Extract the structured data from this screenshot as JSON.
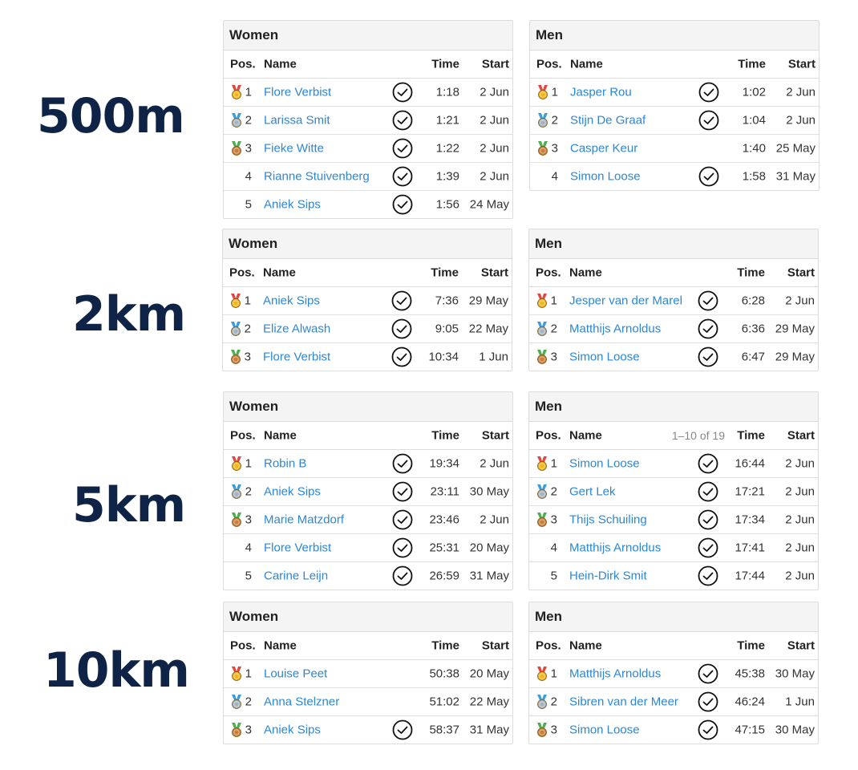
{
  "distances": [
    {
      "label": "500m",
      "women": {
        "title": "Women",
        "range": "",
        "rows": [
          {
            "pos": "1",
            "medal": "gold",
            "name": "Flore Verbist",
            "check": true,
            "time": "1:18",
            "start": "2 Jun"
          },
          {
            "pos": "2",
            "medal": "silver",
            "name": "Larissa Smit",
            "check": true,
            "time": "1:21",
            "start": "2 Jun"
          },
          {
            "pos": "3",
            "medal": "bronze",
            "name": "Fieke Witte",
            "check": true,
            "time": "1:22",
            "start": "2 Jun"
          },
          {
            "pos": "4",
            "medal": "",
            "name": "Rianne Stuivenberg",
            "check": true,
            "time": "1:39",
            "start": "2 Jun"
          },
          {
            "pos": "5",
            "medal": "",
            "name": "Aniek Sips",
            "check": true,
            "time": "1:56",
            "start": "24 May"
          }
        ]
      },
      "men": {
        "title": "Men",
        "range": "",
        "rows": [
          {
            "pos": "1",
            "medal": "gold",
            "name": "Jasper Rou",
            "check": true,
            "time": "1:02",
            "start": "2 Jun"
          },
          {
            "pos": "2",
            "medal": "silver",
            "name": "Stijn De Graaf",
            "check": true,
            "time": "1:04",
            "start": "2 Jun"
          },
          {
            "pos": "3",
            "medal": "bronze",
            "name": "Casper Keur",
            "check": false,
            "time": "1:40",
            "start": "25 May"
          },
          {
            "pos": "4",
            "medal": "",
            "name": "Simon Loose",
            "check": true,
            "time": "1:58",
            "start": "31 May"
          }
        ]
      }
    },
    {
      "label": "2km",
      "women": {
        "title": "Women",
        "range": "",
        "rows": [
          {
            "pos": "1",
            "medal": "gold",
            "name": "Aniek Sips",
            "check": true,
            "time": "7:36",
            "start": "29 May"
          },
          {
            "pos": "2",
            "medal": "silver",
            "name": "Elize Alwash",
            "check": true,
            "time": "9:05",
            "start": "22 May"
          },
          {
            "pos": "3",
            "medal": "bronze",
            "name": "Flore Verbist",
            "check": true,
            "time": "10:34",
            "start": "1 Jun"
          }
        ]
      },
      "men": {
        "title": "Men",
        "range": "",
        "rows": [
          {
            "pos": "1",
            "medal": "gold",
            "name": "Jesper van der Marel",
            "check": true,
            "time": "6:28",
            "start": "2 Jun"
          },
          {
            "pos": "2",
            "medal": "silver",
            "name": "Matthijs Arnoldus",
            "check": true,
            "time": "6:36",
            "start": "29 May"
          },
          {
            "pos": "3",
            "medal": "bronze",
            "name": "Simon Loose",
            "check": true,
            "time": "6:47",
            "start": "29 May"
          }
        ]
      }
    },
    {
      "label": "5km",
      "women": {
        "title": "Women",
        "range": "",
        "rows": [
          {
            "pos": "1",
            "medal": "gold",
            "name": "Robin B",
            "check": true,
            "time": "19:34",
            "start": "2 Jun"
          },
          {
            "pos": "2",
            "medal": "silver",
            "name": "Aniek Sips",
            "check": true,
            "time": "23:11",
            "start": "30 May"
          },
          {
            "pos": "3",
            "medal": "bronze",
            "name": "Marie Matzdorf",
            "check": true,
            "time": "23:46",
            "start": "2 Jun"
          },
          {
            "pos": "4",
            "medal": "",
            "name": "Flore Verbist",
            "check": true,
            "time": "25:31",
            "start": "20 May"
          },
          {
            "pos": "5",
            "medal": "",
            "name": "Carine Leijn",
            "check": true,
            "time": "26:59",
            "start": "31 May"
          }
        ]
      },
      "men": {
        "title": "Men",
        "range": "1–10 of 19",
        "rows": [
          {
            "pos": "1",
            "medal": "gold",
            "name": "Simon Loose",
            "check": true,
            "time": "16:44",
            "start": "2 Jun"
          },
          {
            "pos": "2",
            "medal": "silver",
            "name": "Gert Lek",
            "check": true,
            "time": "17:21",
            "start": "2 Jun"
          },
          {
            "pos": "3",
            "medal": "bronze",
            "name": "Thijs Schuiling",
            "check": true,
            "time": "17:34",
            "start": "2 Jun"
          },
          {
            "pos": "4",
            "medal": "",
            "name": "Matthijs Arnoldus",
            "check": true,
            "time": "17:41",
            "start": "2 Jun"
          },
          {
            "pos": "5",
            "medal": "",
            "name": "Hein-Dirk Smit",
            "check": true,
            "time": "17:44",
            "start": "2 Jun"
          }
        ]
      }
    },
    {
      "label": "10km",
      "women": {
        "title": "Women",
        "range": "",
        "rows": [
          {
            "pos": "1",
            "medal": "gold",
            "name": "Louise Peet",
            "check": false,
            "time": "50:38",
            "start": "20 May"
          },
          {
            "pos": "2",
            "medal": "silver",
            "name": "Anna Stelzner",
            "check": false,
            "time": "51:02",
            "start": "22 May"
          },
          {
            "pos": "3",
            "medal": "bronze",
            "name": "Aniek Sips",
            "check": true,
            "time": "58:37",
            "start": "31 May"
          }
        ]
      },
      "men": {
        "title": "Men",
        "range": "",
        "rows": [
          {
            "pos": "1",
            "medal": "gold",
            "name": "Matthijs Arnoldus",
            "check": true,
            "time": "45:38",
            "start": "30 May"
          },
          {
            "pos": "2",
            "medal": "silver",
            "name": "Sibren van der Meer",
            "check": true,
            "time": "46:24",
            "start": "1 Jun"
          },
          {
            "pos": "3",
            "medal": "bronze",
            "name": "Simon Loose",
            "check": true,
            "time": "47:15",
            "start": "30 May"
          }
        ]
      }
    }
  ],
  "columns": {
    "pos": "Pos.",
    "name": "Name",
    "time": "Time",
    "start": "Start"
  },
  "colors": {
    "label": "#0f2347",
    "link": "#2c87d4",
    "gold": "#f2b51c",
    "silver": "#a6b3bc",
    "bronze": "#c97f3a",
    "ribbon_red": "#e2463d",
    "ribbon_blue": "#3b9ed9",
    "ribbon_green": "#4caf50"
  }
}
